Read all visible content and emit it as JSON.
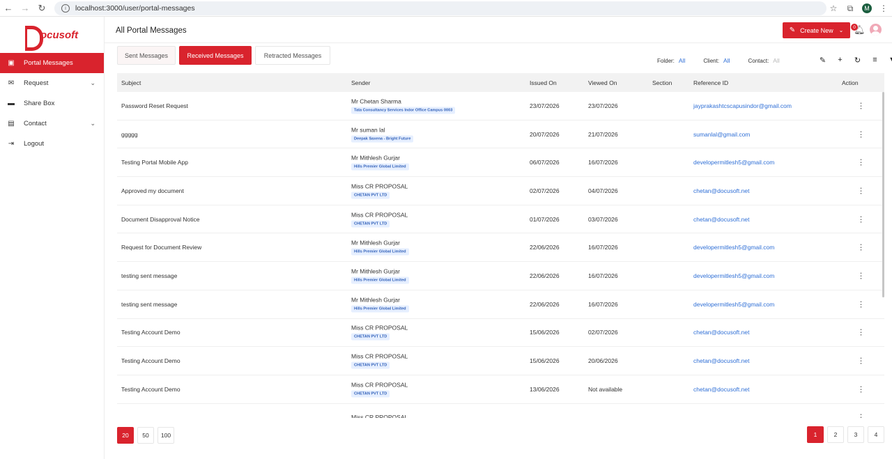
{
  "browser": {
    "url": "localhost:3000/user/portal-messages",
    "profile_initial": "M"
  },
  "brand": {
    "logo_text": "ocusoft"
  },
  "sidebar": {
    "items": [
      {
        "label": "Portal Messages",
        "icon": "inbox-icon",
        "active": true
      },
      {
        "label": "Request",
        "icon": "mail-icon",
        "has_chevron": true
      },
      {
        "label": "Share Box",
        "icon": "folder-icon"
      },
      {
        "label": "Contact",
        "icon": "contact-icon",
        "has_chevron": true
      },
      {
        "label": "Logout",
        "icon": "logout-icon"
      }
    ]
  },
  "header": {
    "title": "All Portal Messages",
    "create_label": "Create New",
    "notification_count": "0"
  },
  "tabs": [
    {
      "label": "Sent Messages"
    },
    {
      "label": "Received Messages",
      "active": true
    },
    {
      "label": "Retracted Messages"
    }
  ],
  "filters": {
    "folder_label": "Folder:",
    "folder_value": "All",
    "client_label": "Client:",
    "client_value": "All",
    "contact_label": "Contact:",
    "contact_value": "All"
  },
  "table": {
    "columns": [
      "Subject",
      "Sender",
      "Issued On",
      "Viewed On",
      "Section",
      "Reference ID",
      "Action"
    ],
    "rows": [
      {
        "subject": "Password Reset Request",
        "sender": "Mr Chetan Sharma",
        "company": "Tata Consultancy Services Indor Office Campus 0003",
        "issued": "23/07/2026",
        "viewed": "23/07/2026",
        "section": "",
        "ref": "jayprakashtcscapusindor@gmail.com"
      },
      {
        "subject": "ggggg",
        "sender": "Mr suman lal",
        "company": "Deepak Saxena - Bright Future",
        "issued": "20/07/2026",
        "viewed": "21/07/2026",
        "section": "",
        "ref": "sumanlal@gmail.com"
      },
      {
        "subject": "Testing Portal Mobile App",
        "sender": "Mr Mithlesh Gurjar",
        "company": "Hills Premier Global Limited",
        "issued": "06/07/2026",
        "viewed": "16/07/2026",
        "section": "",
        "ref": "developermitlesh5@gmail.com"
      },
      {
        "subject": "Approved my document",
        "sender": "Miss CR PROPOSAL",
        "company": "CHETAN PVT LTD",
        "issued": "02/07/2026",
        "viewed": "04/07/2026",
        "section": "",
        "ref": "chetan@docusoft.net"
      },
      {
        "subject": "Document Disapproval Notice",
        "sender": "Miss CR PROPOSAL",
        "company": "CHETAN PVT LTD",
        "issued": "01/07/2026",
        "viewed": "03/07/2026",
        "section": "",
        "ref": "chetan@docusoft.net"
      },
      {
        "subject": "Request for Document Review",
        "sender": "Mr Mithlesh Gurjar",
        "company": "Hills Premier Global Limited",
        "issued": "22/06/2026",
        "viewed": "16/07/2026",
        "section": "",
        "ref": "developermitlesh5@gmail.com"
      },
      {
        "subject": "testing sent message",
        "sender": "Mr Mithlesh Gurjar",
        "company": "Hills Premier Global Limited",
        "issued": "22/06/2026",
        "viewed": "16/07/2026",
        "section": "",
        "ref": "developermitlesh5@gmail.com"
      },
      {
        "subject": "testing sent message",
        "sender": "Mr Mithlesh Gurjar",
        "company": "Hills Premier Global Limited",
        "issued": "22/06/2026",
        "viewed": "16/07/2026",
        "section": "",
        "ref": "developermitlesh5@gmail.com"
      },
      {
        "subject": "Testing Account Demo",
        "sender": "Miss CR PROPOSAL",
        "company": "CHETAN PVT LTD",
        "issued": "15/06/2026",
        "viewed": "02/07/2026",
        "section": "",
        "ref": "chetan@docusoft.net"
      },
      {
        "subject": "Testing Account Demo",
        "sender": "Miss CR PROPOSAL",
        "company": "CHETAN PVT LTD",
        "issued": "15/06/2026",
        "viewed": "20/06/2026",
        "section": "",
        "ref": "chetan@docusoft.net"
      },
      {
        "subject": "Testing Account Demo",
        "sender": "Miss CR PROPOSAL",
        "company": "CHETAN PVT LTD",
        "issued": "13/06/2026",
        "viewed": "Not available",
        "section": "",
        "ref": "chetan@docusoft.net"
      },
      {
        "subject": "",
        "sender": "Miss CR PROPOSAL",
        "company": "",
        "issued": "",
        "viewed": "",
        "section": "",
        "ref": ""
      }
    ]
  },
  "pagination": {
    "page_sizes": [
      "20",
      "50",
      "100"
    ],
    "pages": [
      "1",
      "2",
      "3",
      "4"
    ]
  },
  "colors": {
    "accent": "#d9232d",
    "link": "#2f6fd6"
  }
}
